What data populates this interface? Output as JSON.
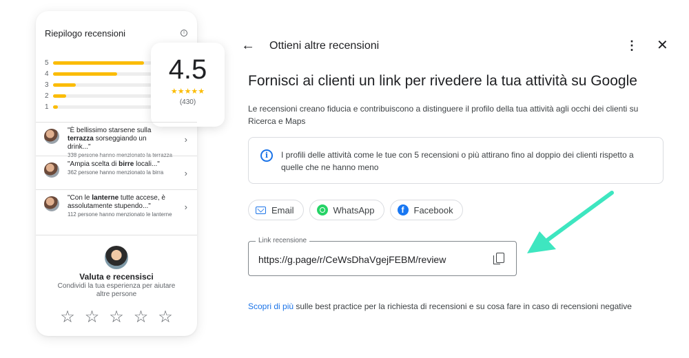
{
  "summary_card": {
    "title": "Riepilogo recensioni",
    "info_icon": "info-icon",
    "rating_bars": [
      {
        "label": "5",
        "fill": 0.92
      },
      {
        "label": "4",
        "fill": 0.65
      },
      {
        "label": "3",
        "fill": 0.23
      },
      {
        "label": "2",
        "fill": 0.13
      },
      {
        "label": "1",
        "fill": 0.05
      }
    ],
    "average": "4.5",
    "stars": "★★★★★",
    "review_count": "(430)",
    "mentions": [
      {
        "pre": "\"È bellissimo starsene sulla ",
        "bold": "terrazza",
        "post": " sorseggiando un drink...\"",
        "sub": "338 persone hanno menzionato la terrazza"
      },
      {
        "pre": "\"Ampia scelta di ",
        "bold": "birre",
        "post": " locali...\"",
        "sub": "362 persone hanno menzionato la birra"
      },
      {
        "pre": "\"Con le ",
        "bold": "lanterne",
        "post": " tutte accese, è assolutamente stupendo...\"",
        "sub": "112 persone hanno menzionato le lanterne"
      }
    ],
    "rate_title": "Valuta e recensisci",
    "rate_subtitle": "Condividi la tua esperienza per aiutare altre persone",
    "empty_star": "☆"
  },
  "dialog": {
    "back_icon": "arrow-left-icon",
    "title": "Ottieni altre recensioni",
    "headline": "Fornisci ai clienti un link per rivedere la tua attività su Google",
    "description": "Le recensioni creano fiducia e contribuiscono a distinguere il profilo della tua attività agli occhi dei clienti su Ricerca e Maps",
    "info_text": "I profili delle attività come le tue con 5 recensioni o più attirano fino al doppio dei clienti rispetto a quelle che ne hanno meno",
    "share_buttons": [
      {
        "label": "Email",
        "icon": "mail-icon"
      },
      {
        "label": "WhatsApp",
        "icon": "whatsapp-icon"
      },
      {
        "label": "Facebook",
        "icon": "facebook-icon"
      }
    ],
    "link_label": "Link recensione",
    "link_value": "https://g.page/r/CeWsDhaVgejFEBM/review",
    "learn_more_link": "Scopri di più",
    "learn_more_text": " sulle best practice per la richiesta di recensioni e su cosa fare in caso di recensioni negative"
  },
  "colors": {
    "star": "#fbbc04",
    "accent_blue": "#1a73e8",
    "arrow": "#3ee6c0",
    "whatsapp": "#25d366",
    "facebook": "#1877f2"
  }
}
